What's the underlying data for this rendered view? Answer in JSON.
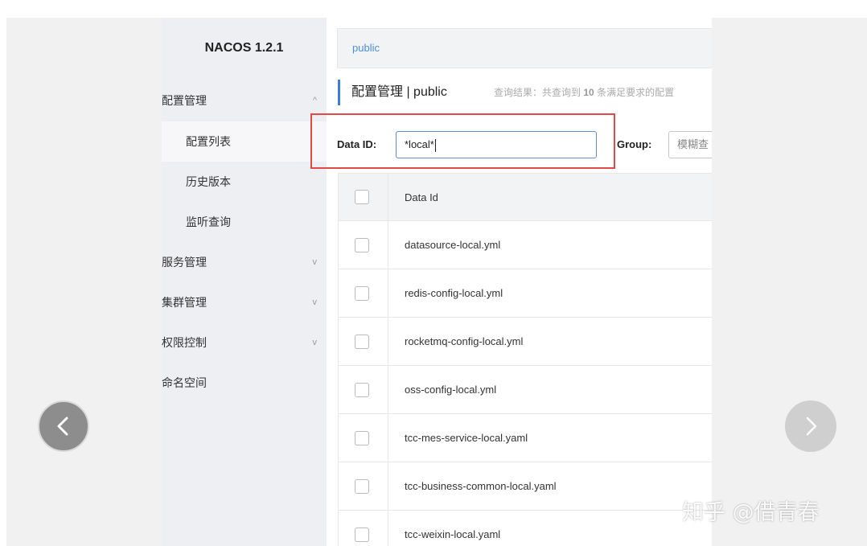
{
  "app": {
    "brand": "NACOS 1.2.1"
  },
  "sidebar": {
    "items": [
      {
        "label": "配置管理",
        "caret": "^"
      },
      {
        "label": "配置列表"
      },
      {
        "label": "历史版本"
      },
      {
        "label": "监听查询"
      },
      {
        "label": "服务管理",
        "caret": "v"
      },
      {
        "label": "集群管理",
        "caret": "v"
      },
      {
        "label": "权限控制",
        "caret": "v"
      },
      {
        "label": "命名空间"
      }
    ]
  },
  "namespace_bar": {
    "current": "public"
  },
  "page": {
    "title": "配置管理 | public",
    "hint_prefix": "查询结果：共查询到",
    "hint_count": "10",
    "hint_suffix": "条满足要求的配置"
  },
  "filters": {
    "data_id_label": "Data ID:",
    "data_id_value": "*local*",
    "group_label": "Group:",
    "group_placeholder": "模糊查"
  },
  "table": {
    "header": "Data Id",
    "rows": [
      "datasource-local.yml",
      "redis-config-local.yml",
      "rocketmq-config-local.yml",
      "oss-config-local.yml",
      "tcc-mes-service-local.yaml",
      "tcc-business-common-local.yaml",
      "tcc-weixin-local.yaml"
    ]
  },
  "watermark": "知乎 @借青春",
  "colors": {
    "accent": "#3b7ddd",
    "highlight": "#e34a45",
    "link": "#4a90d9"
  },
  "icons": {
    "prev": "chevron-left-icon",
    "next": "chevron-right-icon"
  }
}
